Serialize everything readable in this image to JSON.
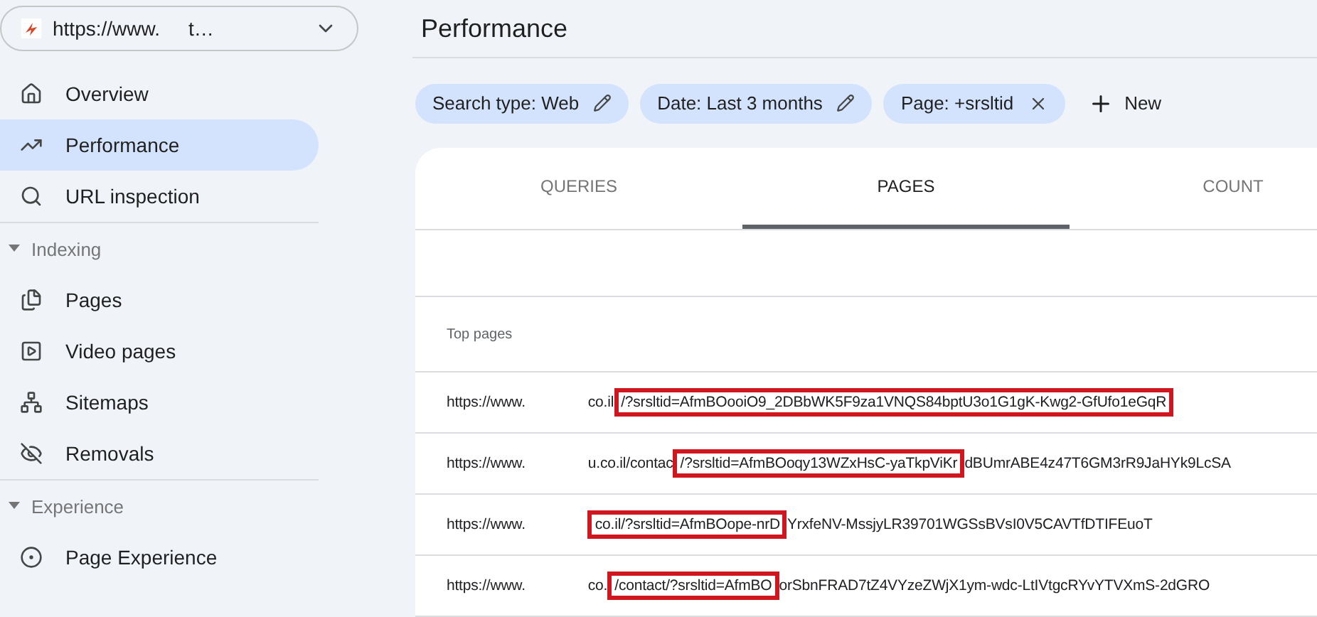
{
  "property": {
    "prefix": "https://www.",
    "suffix": "t…"
  },
  "nav": [
    {
      "kind": "item",
      "label": "Overview",
      "selected": false
    },
    {
      "kind": "item",
      "label": "Performance",
      "selected": true
    },
    {
      "kind": "item",
      "label": "URL inspection",
      "selected": false
    },
    {
      "kind": "section",
      "label": "Indexing",
      "expanded": true
    },
    {
      "kind": "item",
      "label": "Pages",
      "selected": false
    },
    {
      "kind": "item",
      "label": "Video pages",
      "selected": false
    },
    {
      "kind": "item",
      "label": "Sitemaps",
      "selected": false
    },
    {
      "kind": "item",
      "label": "Removals",
      "selected": false
    },
    {
      "kind": "section",
      "label": "Experience",
      "expanded": true
    },
    {
      "kind": "item",
      "label": "Page Experience",
      "selected": false
    }
  ],
  "title": "Performance",
  "filters": [
    {
      "label": "Search type: Web",
      "kind": "edit"
    },
    {
      "label": "Date: Last 3 months",
      "kind": "edit"
    },
    {
      "label": "Page: +srsltid",
      "kind": "remove"
    }
  ],
  "new_button": "New",
  "tabs": [
    {
      "label": "QUERIES",
      "selected": false
    },
    {
      "label": "PAGES",
      "selected": true
    },
    {
      "label": "COUNT",
      "selected": false
    }
  ],
  "table": {
    "header": "Top pages",
    "rows": [
      {
        "start": "https://www.",
        "before": "co.il",
        "highlight": "/?srsltid=AfmBOooiO9_2DBbWK5F9za1VNQS84bptU3o1G1gK-Kwg2-GfUfo1eGqR",
        "after": ""
      },
      {
        "start": "https://www.",
        "before": "u.co.il/contac",
        "highlight": "/?srsltid=AfmBOoqy13WZxHsC-yaTkpViKr",
        "after": "dBUmrABE4z47T6GM3rR9JaHYk9LcSA"
      },
      {
        "start": "https://www.",
        "before": "",
        "highlight": "co.il/?srsltid=AfmBOope-nrD",
        "after": "YrxfeNV-MssjyLR39701WGSsBVsI0V5CAVTfDTIFEuoT"
      },
      {
        "start": "https://www.",
        "before": "co.",
        "highlight": "/contact/?srsltid=AfmBO",
        "after": "orSbnFRAD7tZ4VYzeZWjX1ym-wdc-LtIVtgcRYvYTVXmS-2dGRO"
      }
    ]
  }
}
